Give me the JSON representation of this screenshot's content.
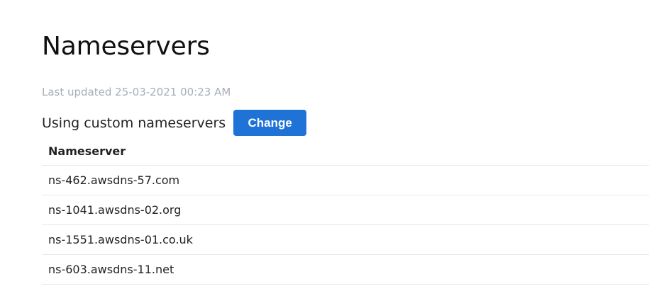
{
  "page": {
    "title": "Nameservers",
    "last_updated": "Last updated 25-03-2021 00:23 AM",
    "status_text": "Using custom nameservers",
    "change_label": "Change"
  },
  "table": {
    "header": "Nameserver",
    "rows": [
      "ns-462.awsdns-57.com",
      "ns-1041.awsdns-02.org",
      "ns-1551.awsdns-01.co.uk",
      "ns-603.awsdns-11.net"
    ]
  },
  "colors": {
    "accent": "#1f72d6",
    "muted_text": "#a6aeb8",
    "divider": "#e6e8eb"
  }
}
